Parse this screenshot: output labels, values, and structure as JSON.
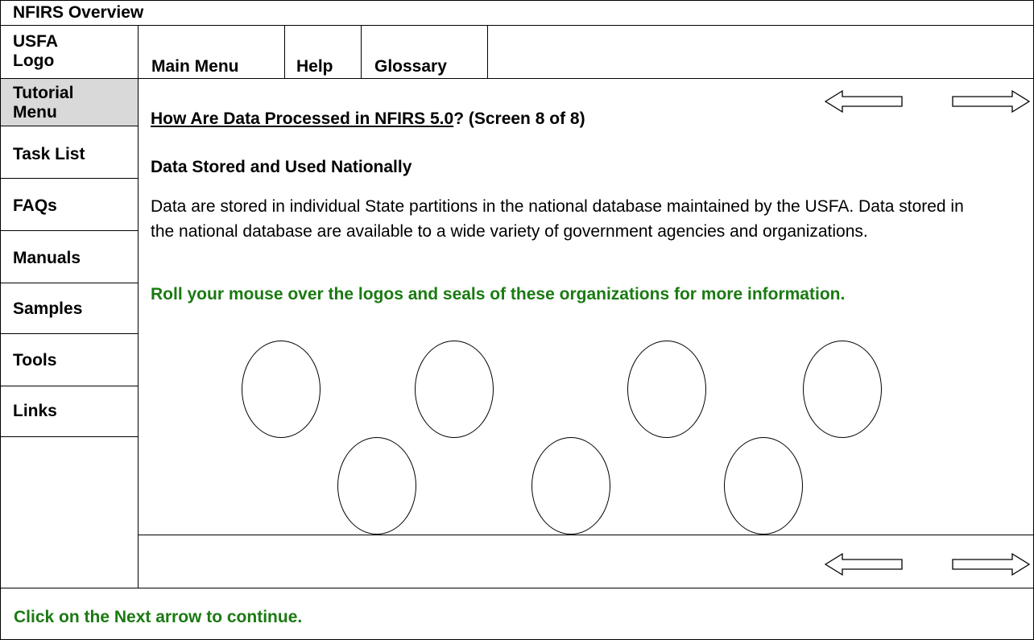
{
  "window": {
    "title": "NFIRS Overview"
  },
  "header": {
    "logo_label": "USFA\nLogo",
    "menu": [
      "Main Menu",
      "Help",
      "Glossary"
    ]
  },
  "sidebar": {
    "items": [
      {
        "label": "Tutorial\nMenu",
        "active": true
      },
      {
        "label": "Task List"
      },
      {
        "label": "FAQs"
      },
      {
        "label": "Manuals"
      },
      {
        "label": "Samples"
      },
      {
        "label": "Tools"
      },
      {
        "label": "Links"
      }
    ]
  },
  "content": {
    "title_link": "How Are Data Processed in NFIRS 5.0",
    "title_rest": "? (Screen 8 of 8)",
    "section_heading": "Data Stored and Used Nationally",
    "body": "Data are stored in individual State partitions in the national database maintained by the USFA.  Data stored in the national database are available to a wide variety of government agencies and organizations.",
    "instruction": "Roll your mouse over the logos and seals of these organizations for more information.",
    "seals": [
      {
        "name": "seal-1"
      },
      {
        "name": "seal-2"
      },
      {
        "name": "seal-3"
      },
      {
        "name": "seal-4"
      },
      {
        "name": "seal-5"
      },
      {
        "name": "seal-6"
      },
      {
        "name": "seal-7"
      }
    ]
  },
  "footer": {
    "instruction": "Click on the Next arrow to continue."
  },
  "colors": {
    "accent_green": "#1a7a12",
    "active_bg": "#d9d9d9",
    "border": "#000000"
  },
  "icons": {
    "prev": "left-arrow-icon",
    "next": "right-arrow-icon"
  }
}
